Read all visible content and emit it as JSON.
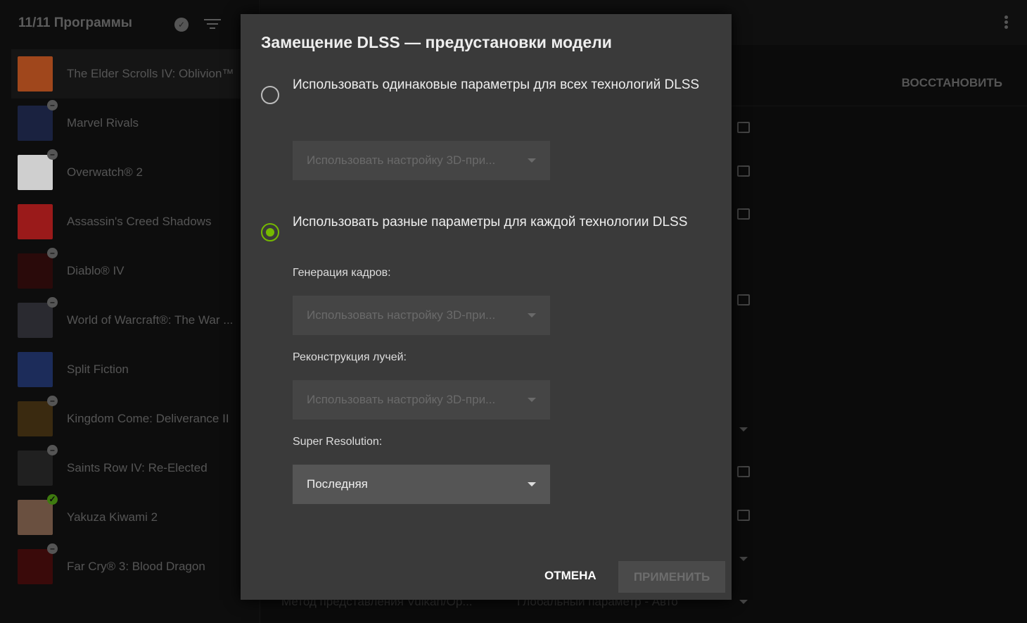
{
  "sidebar": {
    "header": "11/11 Программы",
    "items": [
      {
        "name": "The Elder Scrolls IV: Oblivion™",
        "badge": "",
        "color": "#a0471c"
      },
      {
        "name": "Marvel Rivals",
        "badge": "minus",
        "color": "#1a2240"
      },
      {
        "name": "Overwatch® 2",
        "badge": "minus",
        "color": "#cfcfcf"
      },
      {
        "name": "Assassin's Creed Shadows",
        "badge": "",
        "color": "#9a1a1a"
      },
      {
        "name": "Diablo® IV",
        "badge": "minus",
        "color": "#2a0a0a"
      },
      {
        "name": "World of Warcraft®: The War ...",
        "badge": "minus",
        "color": "#2a2a30"
      },
      {
        "name": "Split Fiction",
        "badge": "",
        "color": "#1c2c5a"
      },
      {
        "name": "Kingdom Come: Deliverance II",
        "badge": "minus",
        "color": "#3a2a10"
      },
      {
        "name": "Saints Row IV: Re-Elected",
        "badge": "minus",
        "color": "#202020"
      },
      {
        "name": "Yakuza Kiwami 2",
        "badge": "check",
        "color": "#6a5040"
      },
      {
        "name": "Far Cry® 3: Blood Dragon",
        "badge": "minus",
        "color": "#3a0a0a"
      }
    ]
  },
  "main": {
    "restore_label": "ВОССТАНОВИТЬ",
    "bg_setting": "Метод представления Vulkan/Op...",
    "bg_value": "Глобальный параметр - Авто"
  },
  "dialog": {
    "title": "Замещение DLSS — предустановки модели",
    "option1": "Использовать одинаковые параметры для всех технологий DLSS",
    "option1_dropdown": "Использовать настройку 3D-при...",
    "option2": "Использовать разные параметры для каждой технологии DLSS",
    "frame_gen_label": "Генерация кадров:",
    "frame_gen_value": "Использовать настройку 3D-при...",
    "ray_recon_label": "Реконструкция лучей:",
    "ray_recon_value": "Использовать настройку 3D-при...",
    "super_res_label": "Super Resolution:",
    "super_res_value": "Последняя",
    "cancel": "ОТМЕНА",
    "apply": "ПРИМЕНИТЬ",
    "selected_option": 2,
    "accent": "#76b900"
  }
}
